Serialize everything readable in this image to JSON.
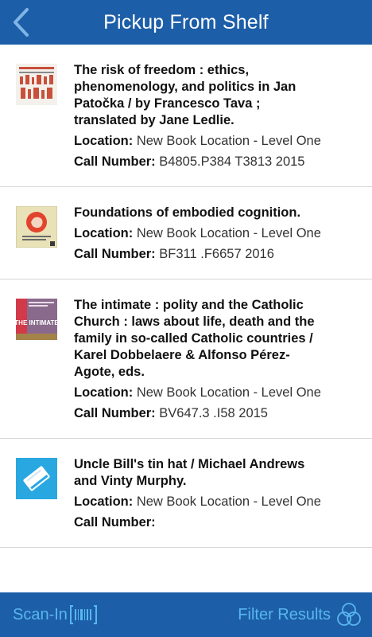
{
  "header": {
    "title": "Pickup From Shelf"
  },
  "items": [
    {
      "title": "The risk of freedom : ethics, phenomenology, and politics in Jan Patočka / by Francesco Tava ; translated by Jane Ledlie.",
      "location_label": "Location:",
      "location": "New Book Location - Level One",
      "call_label": "Call Number:",
      "call_number": "B4805.P384 T3813 2015",
      "cover_icon": "book-cover-risk-of-freedom"
    },
    {
      "title": "Foundations of embodied cognition.",
      "location_label": "Location:",
      "location": "New Book Location - Level One",
      "call_label": "Call Number:",
      "call_number": "BF311 .F6657 2016",
      "cover_icon": "book-cover-embodied-cognition"
    },
    {
      "title": "The intimate : polity and the Catholic Church : laws about life, death and the family in so-called Catholic countries / Karel Dobbelaere & Alfonso Pérez-Agote, eds.",
      "location_label": "Location:",
      "location": "New Book Location - Level One",
      "call_label": "Call Number:",
      "call_number": "BV647.3 .I58 2015",
      "cover_icon": "book-cover-the-intimate",
      "cover_text": "THE INTIMATE"
    },
    {
      "title": "Uncle Bill's tin hat / Michael Andrews and Vinty Murphy.",
      "location_label": "Location:",
      "location": "New Book Location - Level One",
      "call_label": "Call Number:",
      "call_number": "",
      "cover_icon": "generic-book-icon"
    }
  ],
  "footer": {
    "scan_label": "Scan-In",
    "filter_label": "Filter Results",
    "scan_icon": "barcode-icon",
    "filter_icon": "venn-filter-icon"
  },
  "colors": {
    "bar": "#1d5ea8",
    "footer_text": "#57b7ee",
    "header_text": "#ffffff"
  }
}
